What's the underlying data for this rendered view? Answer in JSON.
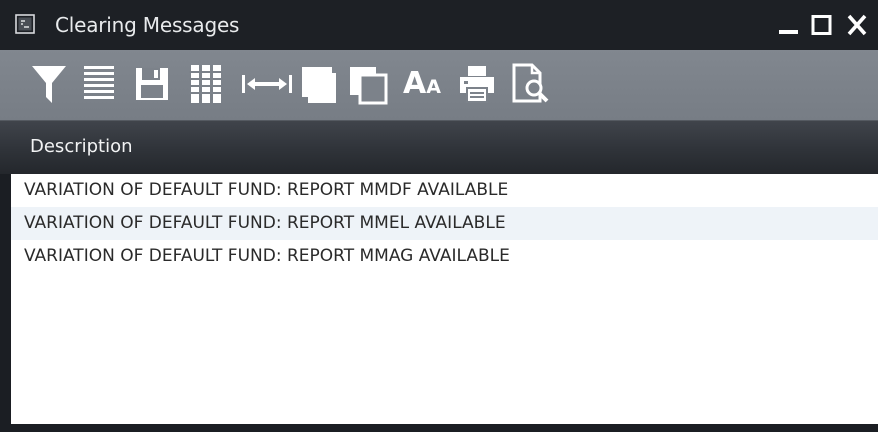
{
  "window": {
    "title": "Clearing Messages",
    "icon": "app-window-icon",
    "controls": [
      "minimize-icon",
      "maximize-icon",
      "close-icon"
    ]
  },
  "toolbar": {
    "buttons": [
      {
        "name": "filter",
        "icon": "funnel-icon"
      },
      {
        "name": "rows",
        "icon": "rows-icon"
      },
      {
        "name": "save",
        "icon": "floppy-disk-icon"
      },
      {
        "name": "columns",
        "icon": "columns-grid-icon"
      },
      {
        "name": "fit-width",
        "icon": "fit-width-arrows-icon"
      },
      {
        "name": "bring-front",
        "icon": "bring-to-front-icon"
      },
      {
        "name": "send-back",
        "icon": "send-to-back-icon"
      },
      {
        "name": "font-size",
        "icon": "font-size-icon"
      },
      {
        "name": "print",
        "icon": "printer-icon"
      },
      {
        "name": "print-preview",
        "icon": "print-preview-icon"
      }
    ],
    "font_size_label": "A",
    "font_size_label_small": "A"
  },
  "table": {
    "columns": [
      "Description"
    ],
    "rows": [
      "VARIATION OF DEFAULT FUND: REPORT MMDF AVAILABLE",
      "VARIATION OF DEFAULT FUND: REPORT MMEL AVAILABLE",
      "VARIATION OF DEFAULT FUND: REPORT MMAG AVAILABLE"
    ]
  },
  "colors": {
    "titlebar": "#1d2025",
    "toolbar": "#7c828a",
    "header": "#2f3339",
    "row_alt": "#eef3f8",
    "icon": "#ffffff"
  }
}
